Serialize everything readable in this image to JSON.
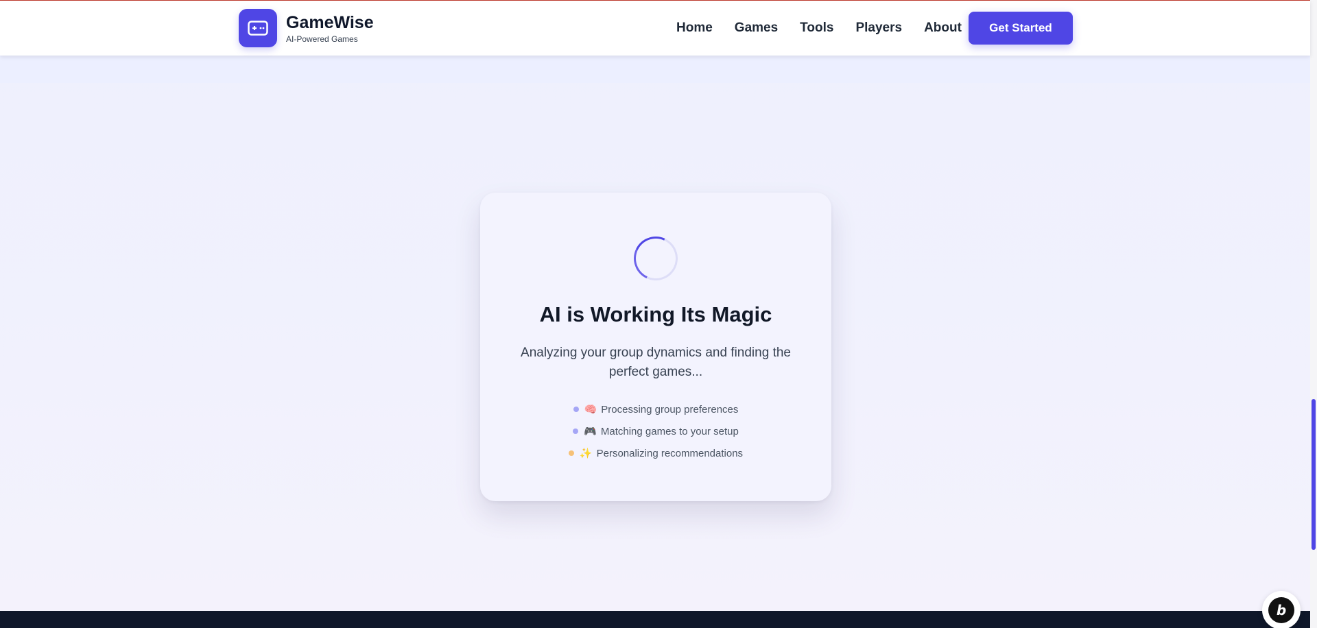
{
  "brand": {
    "name": "GameWise",
    "tagline": "AI-Powered Games"
  },
  "nav": {
    "links": [
      "Home",
      "Games",
      "Tools",
      "Players",
      "About"
    ],
    "cta": "Get Started"
  },
  "loading": {
    "title": "AI is Working Its Magic",
    "subtitle": "Analyzing your group dynamics and finding the perfect games...",
    "steps": [
      {
        "emoji": "🧠",
        "text": "Processing group preferences",
        "dot_color": "#a5a6f6"
      },
      {
        "emoji": "🎮",
        "text": "Matching games to your setup",
        "dot_color": "#a5a6f6"
      },
      {
        "emoji": "✨",
        "text": "Personalizing recommendations",
        "dot_color": "#f6c177"
      }
    ]
  },
  "chat_widget": {
    "letter": "b"
  },
  "colors": {
    "accent": "#4f46e5",
    "footer": "#0f172a"
  }
}
